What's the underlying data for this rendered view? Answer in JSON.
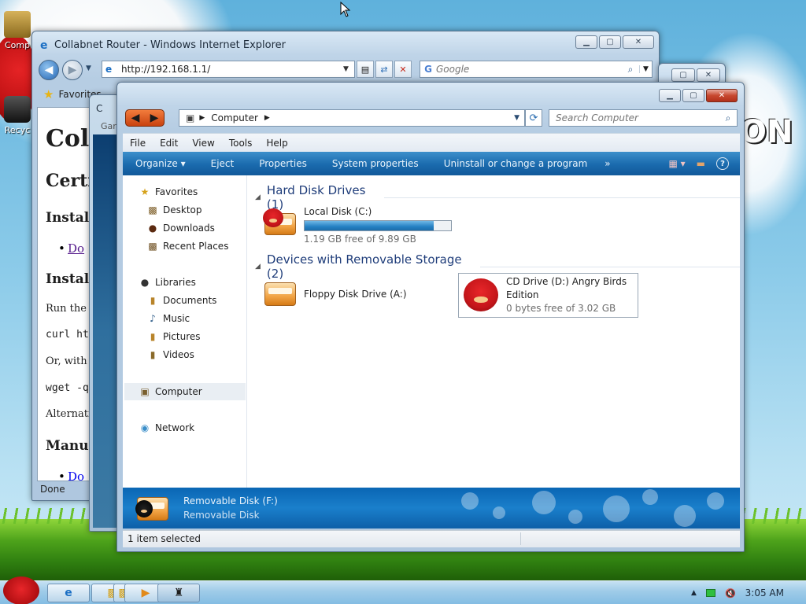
{
  "desktop": {
    "icons": [
      {
        "label": "Comp",
        "icon": "computer-icon"
      },
      {
        "label": "Recyc",
        "icon": "recycle-bin-icon"
      }
    ],
    "logo_text": "ON"
  },
  "ie": {
    "title": "Collabnet Router - Windows Internet Explorer",
    "address": "http://192.168.1.1/",
    "search_placeholder": "Google",
    "favorites_label": "Favorites",
    "status": "Done",
    "page": {
      "h1": "Coll",
      "h2": "Certi",
      "h3a": "Install",
      "li1": "Do",
      "h3b": "Install",
      "p1": "Run the f",
      "code1": "curl ht",
      "p2": "Or, with",
      "code2": "wget -q",
      "p3": "Alternativ",
      "h3c": "Manua",
      "li2": "Do"
    }
  },
  "back_window": {
    "title": "C",
    "subtitle": "Gar"
  },
  "explorer": {
    "breadcrumb": "Computer",
    "search_placeholder": "Search Computer",
    "menu": [
      "File",
      "Edit",
      "View",
      "Tools",
      "Help"
    ],
    "commands": [
      "Organize ▾",
      "Eject",
      "Properties",
      "System properties",
      "Uninstall or change a program",
      "»"
    ],
    "sidebar": {
      "favorites": {
        "label": "Favorites",
        "items": [
          "Desktop",
          "Downloads",
          "Recent Places"
        ]
      },
      "libraries": {
        "label": "Libraries",
        "items": [
          "Documents",
          "Music",
          "Pictures",
          "Videos"
        ]
      },
      "computer": "Computer",
      "network": "Network"
    },
    "groups": {
      "hdd": {
        "title": "Hard Disk Drives (1)"
      },
      "removable": {
        "title": "Devices with Removable Storage (2)"
      }
    },
    "drives": {
      "c": {
        "name": "Local Disk (C:)",
        "free": "1.19 GB free of 9.89 GB",
        "used_fraction": 0.88
      },
      "a": {
        "name": "Floppy Disk Drive (A:)"
      },
      "d": {
        "name_line1": "CD Drive (D:) Angry Birds",
        "name_line2": "Edition",
        "free": "0 bytes free of 3.02 GB"
      }
    },
    "details": {
      "name": "Removable Disk (F:)",
      "type": "Removable Disk"
    },
    "status": "1 item selected"
  },
  "taskbar": {
    "clock": "3:05 AM"
  }
}
